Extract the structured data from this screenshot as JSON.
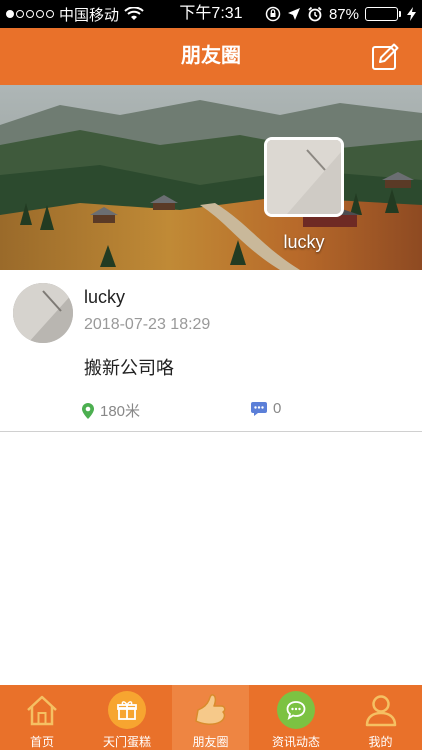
{
  "status_bar": {
    "carrier": "中国移动",
    "time": "下午7:31",
    "battery": "87%",
    "battery_level": 0.87
  },
  "header": {
    "title": "朋友圈",
    "edit_icon": "edit-icon"
  },
  "cover": {
    "user_name": "lucky"
  },
  "posts": [
    {
      "author": "lucky",
      "time": "2018-07-23 18:29",
      "content": "搬新公司咯",
      "distance": "180米",
      "comment_count": "0"
    }
  ],
  "tab_bar": {
    "active_tab": "朋友圈",
    "tabs": [
      {
        "label": "首页",
        "icon": "home-icon"
      },
      {
        "label": "天门蛋糕",
        "icon": "cake-box-icon"
      },
      {
        "label": "朋友圈",
        "icon": "thumbs-up-icon"
      },
      {
        "label": "资讯动态",
        "icon": "chat-bubble-icon"
      },
      {
        "label": "我的",
        "icon": "user-icon"
      }
    ]
  },
  "colors": {
    "brand_orange": "#e9712a",
    "location_green": "#4caf50",
    "comment_blue": "#5b7fd8"
  }
}
